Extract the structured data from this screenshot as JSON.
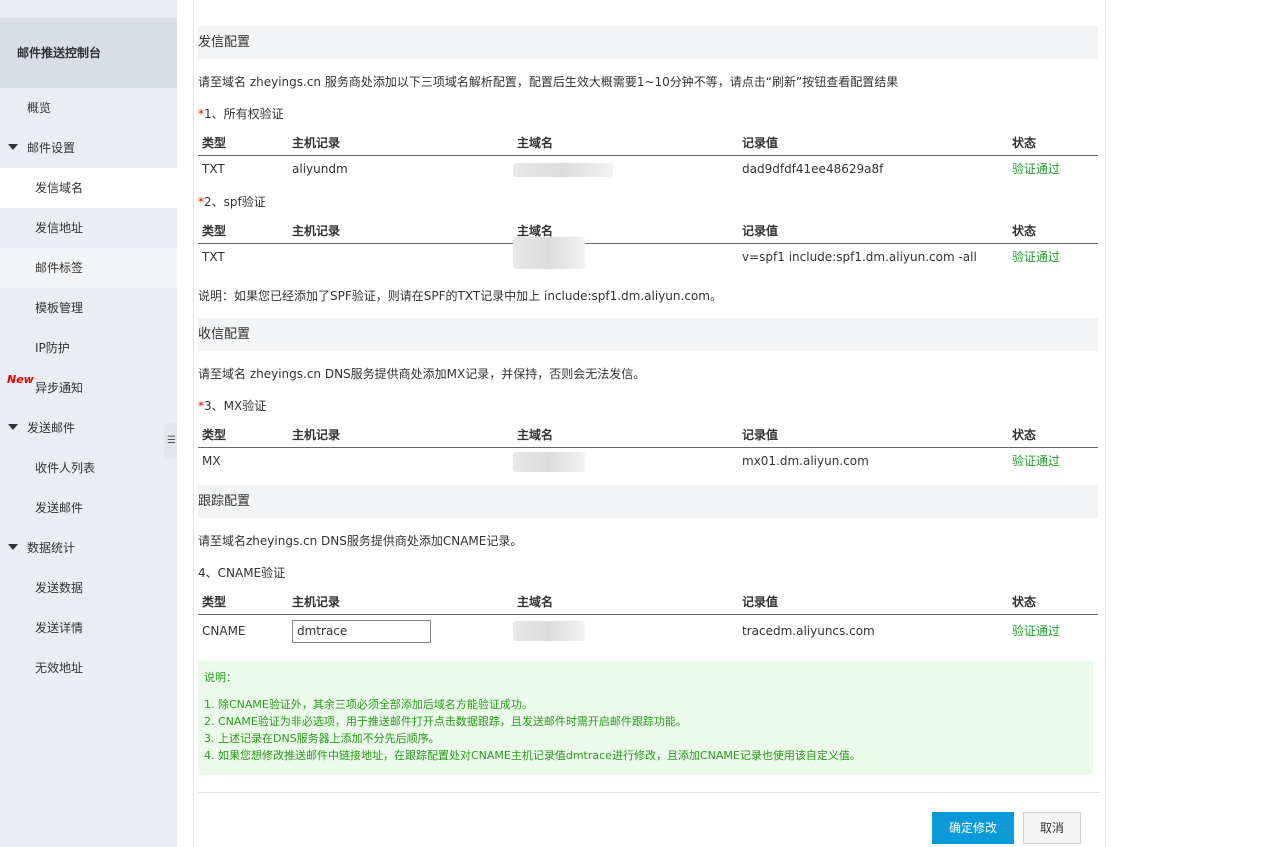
{
  "sidebar": {
    "title": "邮件推送控制台",
    "items": [
      {
        "label": "概览"
      },
      {
        "label": "邮件设置"
      },
      {
        "label": "发信域名"
      },
      {
        "label": "发信地址"
      },
      {
        "label": "邮件标签"
      },
      {
        "label": "模板管理"
      },
      {
        "label": "IP防护"
      },
      {
        "label": "异步通知"
      },
      {
        "label": "发送邮件"
      },
      {
        "label": "收件人列表"
      },
      {
        "label": "发送邮件"
      },
      {
        "label": "数据统计"
      },
      {
        "label": "发送数据"
      },
      {
        "label": "发送详情"
      },
      {
        "label": "无效地址"
      }
    ],
    "new_badge": "New",
    "collapse_icon": "menu-collapse-icon"
  },
  "send_config": {
    "title": "发信配置",
    "description": "请至域名 zheyings.cn 服务商处添加以下三项域名解析配置，配置后生效大概需要1~10分钟不等，请点击“刷新”按钮查看配置结果",
    "ownership": {
      "star": "*",
      "label": "1、所有权验证",
      "row": {
        "type": "TXT",
        "host": "aliyundm",
        "value": "dad9dfdf41ee48629a8f",
        "status": "验证通过"
      }
    },
    "spf": {
      "star": "*",
      "label": "2、spf验证",
      "row": {
        "type": "TXT",
        "host": "",
        "value": "v=spf1 include:spf1.dm.aliyun.com -all",
        "status": "验证通过"
      }
    },
    "note": "说明：如果您已经添加了SPF验证，则请在SPF的TXT记录中加上 include:spf1.dm.aliyun.com。"
  },
  "receive_config": {
    "title": "收信配置",
    "description": "请至域名 zheyings.cn DNS服务提供商处添加MX记录，并保持，否则会无法发信。",
    "mx": {
      "star": "*",
      "label": "3、MX验证",
      "row": {
        "type": "MX",
        "host": "",
        "value": "mx01.dm.aliyun.com",
        "status": "验证通过"
      }
    }
  },
  "tracking_config": {
    "title": "跟踪配置",
    "description": "请至域名zheyings.cn DNS服务提供商处添加CNAME记录。",
    "cname": {
      "label": "4、CNAME验证",
      "row": {
        "type": "CNAME",
        "host": "dmtrace",
        "value": "tracedm.aliyuncs.com",
        "status": "验证通过"
      }
    }
  },
  "table_headers": {
    "type": "类型",
    "host": "主机记录",
    "domain": "主域名",
    "value": "记录值",
    "status": "状态"
  },
  "notice": {
    "title": "说明：",
    "lines": [
      "1. 除CNAME验证外，其余三项必须全部添加后域名方能验证成功。",
      "2. CNAME验证为非必选项，用于推送邮件打开点击数据跟踪，且发送邮件时需开启邮件跟踪功能。",
      "3. 上述记录在DNS服务器上添加不分先后顺序。",
      "4. 如果您想修改推送邮件中链接地址，在跟踪配置处对CNAME主机记录值dmtrace进行修改，且添加CNAME记录也使用该自定义值。"
    ]
  },
  "buttons": {
    "confirm": "确定修改",
    "cancel": "取消"
  },
  "colors": {
    "accent": "#0a9ad8",
    "success": "#1e9e2c",
    "required": "#ee0000",
    "notice_bg": "#ebfbe9"
  }
}
